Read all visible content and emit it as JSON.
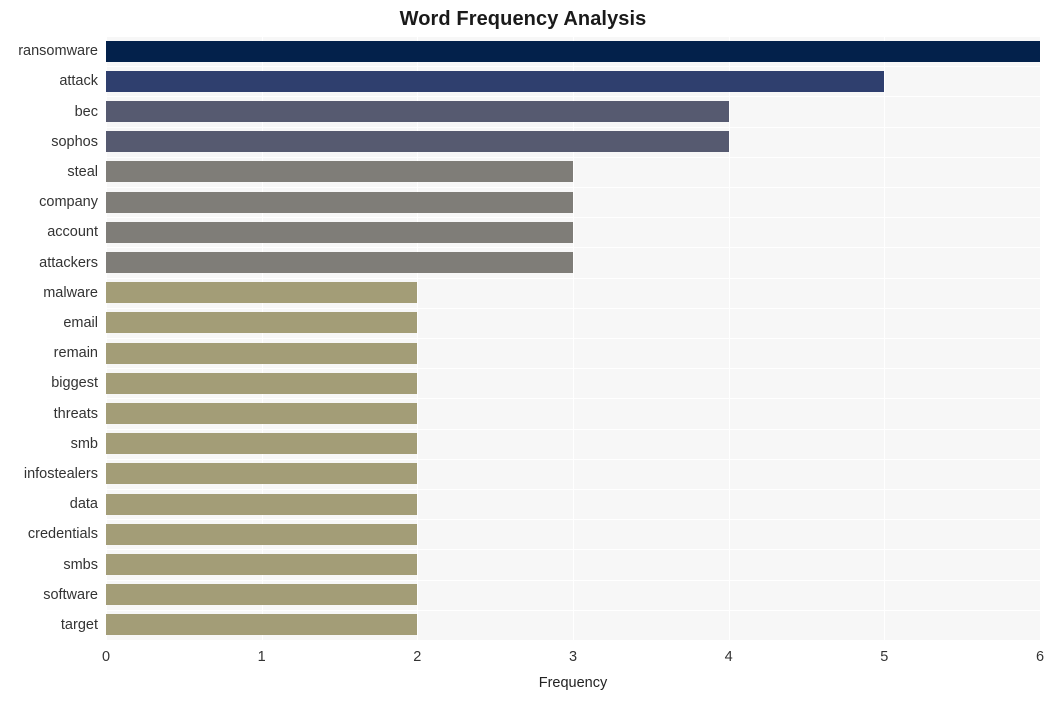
{
  "chart_data": {
    "type": "bar",
    "orientation": "horizontal",
    "title": "Word Frequency Analysis",
    "xlabel": "Frequency",
    "ylabel": "",
    "xlim": [
      0,
      6
    ],
    "xticks": [
      0,
      1,
      2,
      3,
      4,
      5,
      6
    ],
    "xtick_labels": [
      "0",
      "1",
      "2",
      "3",
      "4",
      "5",
      "6"
    ],
    "grid": true,
    "legend": false,
    "categories": [
      "ransomware",
      "attack",
      "bec",
      "sophos",
      "steal",
      "company",
      "account",
      "attackers",
      "malware",
      "email",
      "remain",
      "biggest",
      "threats",
      "smb",
      "infostealers",
      "data",
      "credentials",
      "smbs",
      "software",
      "target"
    ],
    "values": [
      6,
      5,
      4,
      4,
      3,
      3,
      3,
      3,
      2,
      2,
      2,
      2,
      2,
      2,
      2,
      2,
      2,
      2,
      2,
      2
    ],
    "bar_colors": [
      "#03214b",
      "#2f3f6e",
      "#565a70",
      "#565a70",
      "#7f7d78",
      "#7f7d78",
      "#7f7d78",
      "#7f7d78",
      "#a39d77",
      "#a39d77",
      "#a39d77",
      "#a39d77",
      "#a39d77",
      "#a39d77",
      "#a39d77",
      "#a39d77",
      "#a39d77",
      "#a39d77",
      "#a39d77",
      "#a39d77"
    ],
    "plot_background": "#f7f7f7",
    "gridline_color": "#ffffff",
    "page_background": "#ffffff",
    "title_color": "#1a1a1a",
    "tick_label_color": "#333333"
  }
}
